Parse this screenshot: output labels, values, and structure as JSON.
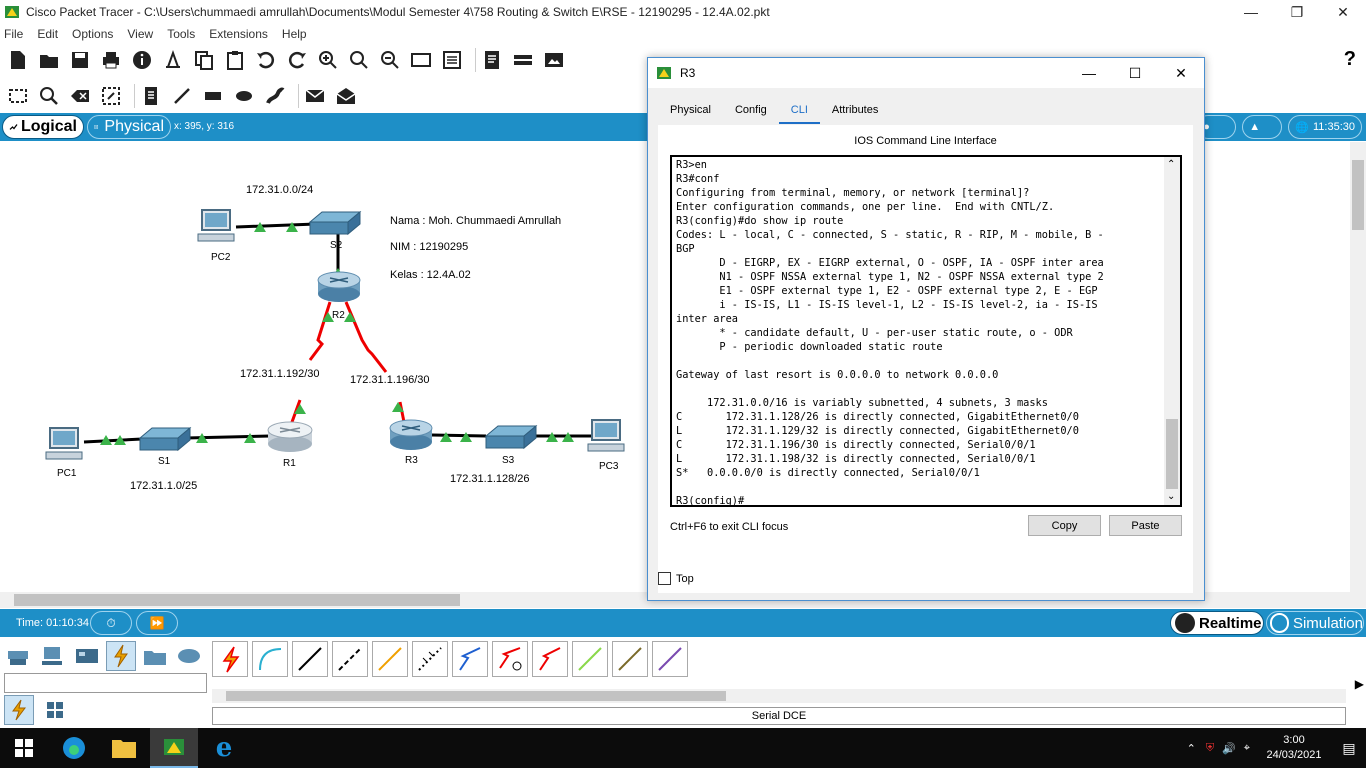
{
  "window": {
    "title": "Cisco Packet Tracer - C:\\Users\\chummaedi amrullah\\Documents\\Modul Semester 4\\758 Routing & Switch E\\RSE - 12190295 - 12.4A.02.pkt"
  },
  "menu": [
    "File",
    "Edit",
    "Options",
    "View",
    "Tools",
    "Extensions",
    "Help"
  ],
  "workspace": {
    "logical_label": "Logical",
    "physical_label": "Physical",
    "coords": "x: 395, y: 316",
    "clock_time": "11:35:30"
  },
  "topology": {
    "networks": {
      "lan2": "172.31.0.0/24",
      "wan1": "172.31.1.192/30",
      "wan2": "172.31.1.196/30",
      "lan1": "172.31.1.0/25",
      "lan3": "172.31.1.128/26"
    },
    "notes": {
      "name": "Nama : Moh. Chummaedi Amrullah",
      "nim": "NIM : 12190295",
      "kelas": "Kelas : 12.4A.02"
    },
    "devices": {
      "pc2": "PC2",
      "s2": "S2",
      "r2": "R2",
      "pc1": "PC1",
      "s1": "S1",
      "r1": "R1",
      "r3": "R3",
      "s3": "S3",
      "pc3": "PC3"
    }
  },
  "timebar": {
    "time": "Time: 01:10:34",
    "realtime": "Realtime",
    "simulation": "Simulation"
  },
  "device_panel": {
    "selected_connection": "Serial DCE"
  },
  "dialog": {
    "title": "R3",
    "tabs": [
      "Physical",
      "Config",
      "CLI",
      "Attributes"
    ],
    "active_tab": "CLI",
    "heading": "IOS Command Line Interface",
    "cli_lines": [
      "R3>en",
      "R3#conf",
      "Configuring from terminal, memory, or network [terminal]?",
      "Enter configuration commands, one per line.  End with CNTL/Z.",
      "R3(config)#do show ip route",
      "Codes: L - local, C - connected, S - static, R - RIP, M - mobile, B -",
      "BGP",
      "       D - EIGRP, EX - EIGRP external, O - OSPF, IA - OSPF inter area",
      "       N1 - OSPF NSSA external type 1, N2 - OSPF NSSA external type 2",
      "       E1 - OSPF external type 1, E2 - OSPF external type 2, E - EGP",
      "       i - IS-IS, L1 - IS-IS level-1, L2 - IS-IS level-2, ia - IS-IS",
      "inter area",
      "       * - candidate default, U - per-user static route, o - ODR",
      "       P - periodic downloaded static route",
      "",
      "Gateway of last resort is 0.0.0.0 to network 0.0.0.0",
      "",
      "     172.31.0.0/16 is variably subnetted, 4 subnets, 3 masks",
      "C       172.31.1.128/26 is directly connected, GigabitEthernet0/0",
      "L       172.31.1.129/32 is directly connected, GigabitEthernet0/0",
      "C       172.31.1.196/30 is directly connected, Serial0/0/1",
      "L       172.31.1.198/32 is directly connected, Serial0/0/1",
      "S*   0.0.0.0/0 is directly connected, Serial0/0/1",
      "",
      "R3(config)#"
    ],
    "hint": "Ctrl+F6 to exit CLI focus",
    "copy": "Copy",
    "paste": "Paste",
    "top_label": "Top"
  },
  "taskbar": {
    "time": "3:00",
    "date": "24/03/2021"
  }
}
